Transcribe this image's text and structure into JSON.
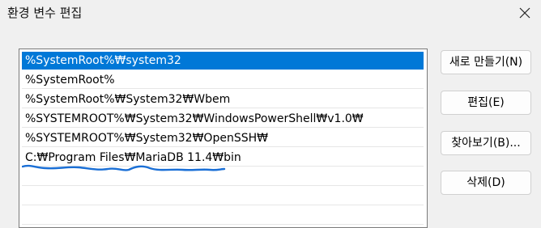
{
  "window": {
    "title": "환경 변수 편집",
    "close_icon": "close-icon"
  },
  "path_list": {
    "items": [
      {
        "text": "%SystemRoot%₩system32",
        "selected": true
      },
      {
        "text": "%SystemRoot%",
        "selected": false
      },
      {
        "text": "%SystemRoot%₩System32₩Wbem",
        "selected": false
      },
      {
        "text": "%SYSTEMROOT%₩System32₩WindowsPowerShell₩v1.0₩",
        "selected": false
      },
      {
        "text": "%SYSTEMROOT%₩System32₩OpenSSH₩",
        "selected": false
      },
      {
        "text": "C:₩Program Files₩MariaDB 11.4₩bin",
        "selected": false
      }
    ],
    "selection_color": "#0078d7",
    "annotation_color": "#1a6fd6"
  },
  "buttons": {
    "new": "새로 만들기(N)",
    "edit": "편집(E)",
    "browse": "찾아보기(B)...",
    "delete": "삭제(D)"
  }
}
